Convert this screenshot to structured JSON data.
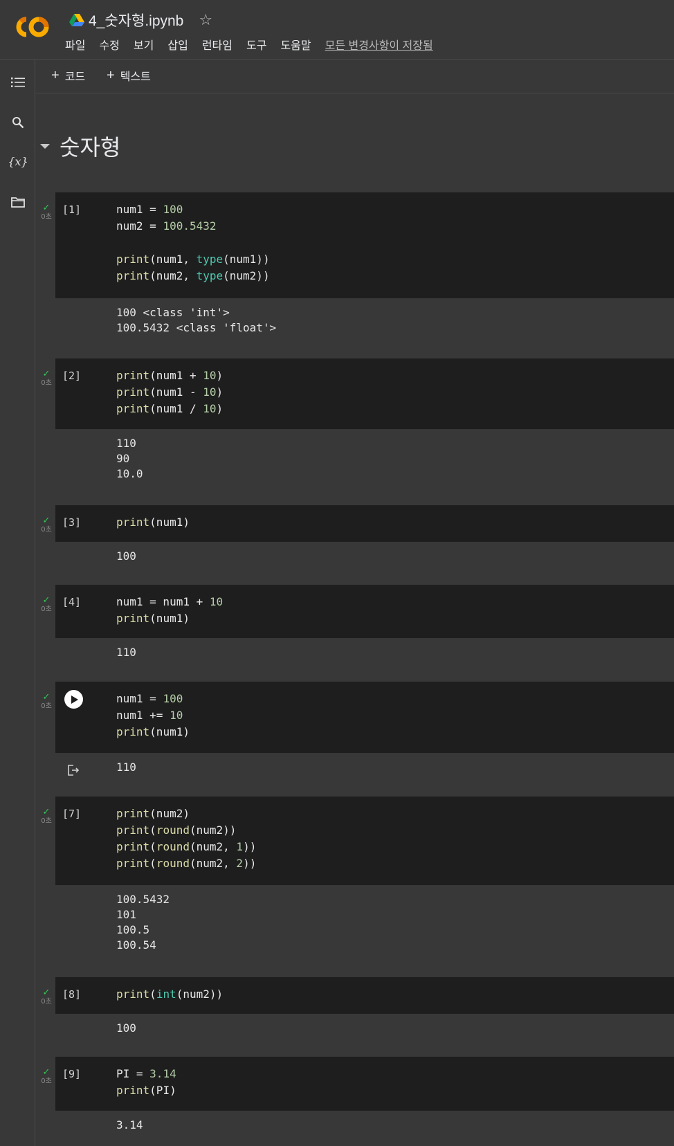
{
  "header": {
    "title": "4_숫자형.ipynb",
    "menu": [
      "파일",
      "수정",
      "보기",
      "삽입",
      "런타임",
      "도구",
      "도움말"
    ],
    "save_status": "모든 변경사항이 저장됨",
    "logo_text": "CO"
  },
  "rail": {
    "icons": [
      "table-of-contents-icon",
      "search-icon",
      "variables-icon",
      "folder-icon"
    ],
    "variables_label": "{x}"
  },
  "toolbar": {
    "add_code": "코드",
    "add_text": "텍스트"
  },
  "section": {
    "title": "숫자형"
  },
  "cells": [
    {
      "exec_count": "[1]",
      "time": "0초",
      "code": [
        [
          [
            "t",
            "num1 = "
          ],
          [
            "num",
            "100"
          ]
        ],
        [
          [
            "t",
            "num2 = "
          ],
          [
            "num",
            "100.5432"
          ]
        ],
        [
          [
            "t",
            ""
          ]
        ],
        [
          [
            "kw",
            "print"
          ],
          [
            "t",
            "(num1, "
          ],
          [
            "bi",
            "type"
          ],
          [
            "t",
            "(num1))"
          ]
        ],
        [
          [
            "kw",
            "print"
          ],
          [
            "t",
            "(num2, "
          ],
          [
            "bi",
            "type"
          ],
          [
            "t",
            "(num2))"
          ]
        ]
      ],
      "output": [
        "100 <class 'int'>",
        "100.5432 <class 'float'>"
      ]
    },
    {
      "exec_count": "[2]",
      "time": "0초",
      "code": [
        [
          [
            "kw",
            "print"
          ],
          [
            "t",
            "(num1 + "
          ],
          [
            "num",
            "10"
          ],
          [
            "t",
            ")"
          ]
        ],
        [
          [
            "kw",
            "print"
          ],
          [
            "t",
            "(num1 - "
          ],
          [
            "num",
            "10"
          ],
          [
            "t",
            ")"
          ]
        ],
        [
          [
            "kw",
            "print"
          ],
          [
            "t",
            "(num1 / "
          ],
          [
            "num",
            "10"
          ],
          [
            "t",
            ")"
          ]
        ]
      ],
      "output": [
        "110",
        "90",
        "10.0"
      ]
    },
    {
      "exec_count": "[3]",
      "time": "0초",
      "code": [
        [
          [
            "kw",
            "print"
          ],
          [
            "t",
            "(num1)"
          ]
        ]
      ],
      "output": [
        "100"
      ]
    },
    {
      "exec_count": "[4]",
      "time": "0초",
      "code": [
        [
          [
            "t",
            "num1 = num1 + "
          ],
          [
            "num",
            "10"
          ]
        ],
        [
          [
            "kw",
            "print"
          ],
          [
            "t",
            "(num1)"
          ]
        ]
      ],
      "output": [
        "110"
      ]
    },
    {
      "exec_count": "",
      "time": "0초",
      "focused": true,
      "code": [
        [
          [
            "t",
            "num1 = "
          ],
          [
            "num",
            "100"
          ]
        ],
        [
          [
            "t",
            "num1 += "
          ],
          [
            "num",
            "10"
          ]
        ],
        [
          [
            "kw",
            "print"
          ],
          [
            "t",
            "(num1)"
          ]
        ]
      ],
      "output": [
        "110"
      ]
    },
    {
      "exec_count": "[7]",
      "time": "0초",
      "code": [
        [
          [
            "kw",
            "print"
          ],
          [
            "t",
            "(num2)"
          ]
        ],
        [
          [
            "kw",
            "print"
          ],
          [
            "t",
            "("
          ],
          [
            "kw",
            "round"
          ],
          [
            "t",
            "(num2))"
          ]
        ],
        [
          [
            "kw",
            "print"
          ],
          [
            "t",
            "("
          ],
          [
            "kw",
            "round"
          ],
          [
            "t",
            "(num2, "
          ],
          [
            "num",
            "1"
          ],
          [
            "t",
            "))"
          ]
        ],
        [
          [
            "kw",
            "print"
          ],
          [
            "t",
            "("
          ],
          [
            "kw",
            "round"
          ],
          [
            "t",
            "(num2, "
          ],
          [
            "num",
            "2"
          ],
          [
            "t",
            "))"
          ]
        ]
      ],
      "output": [
        "100.5432",
        "101",
        "100.5",
        "100.54"
      ]
    },
    {
      "exec_count": "[8]",
      "time": "0초",
      "code": [
        [
          [
            "kw",
            "print"
          ],
          [
            "t",
            "("
          ],
          [
            "bi",
            "int"
          ],
          [
            "t",
            "(num2))"
          ]
        ]
      ],
      "output": [
        "100"
      ]
    },
    {
      "exec_count": "[9]",
      "time": "0초",
      "code": [
        [
          [
            "t",
            "PI = "
          ],
          [
            "num",
            "3.14"
          ]
        ],
        [
          [
            "kw",
            "print"
          ],
          [
            "t",
            "(PI)"
          ]
        ]
      ],
      "output": [
        "3.14"
      ]
    }
  ],
  "colors": {
    "background": "#383838",
    "code_background": "#1e1e1e",
    "keyword": "#dcdcaa",
    "builtin": "#4ec9b0",
    "number": "#b5cea8",
    "check": "#34c759"
  }
}
